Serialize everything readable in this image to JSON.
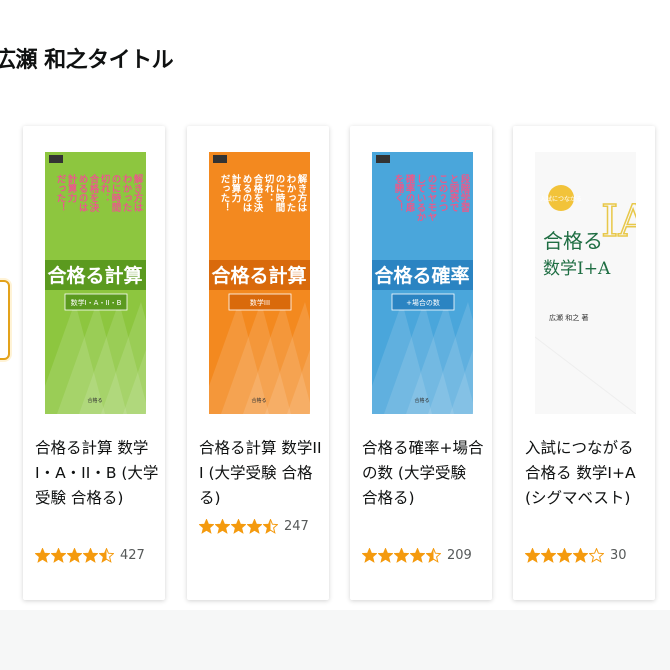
{
  "section": {
    "title": "広瀬 和之タイトル"
  },
  "colors": {
    "star": "#f49a0e",
    "focus_border": "#e3a21a"
  },
  "products": [
    {
      "title": "合格る計算 数学I・A・II・B (大学受験 合格る)",
      "rating": 4.5,
      "reviews": "427",
      "cover": {
        "bg": "#8dc63f",
        "banner": "#5b9a1f",
        "vertical_color": "#e95a8b",
        "big": "合格る計算",
        "sub": "数学I・A・II・B",
        "label": "合格る",
        "vertical": [
          "解き方は",
          "わかった",
          "のに時間",
          "切れ：",
          "合格を決",
          "めるのは",
          "計算力",
          "だった！"
        ]
      }
    },
    {
      "title": "合格る計算 数学III (大学受験 合格る)",
      "rating": 4.5,
      "reviews": "247",
      "cover": {
        "bg": "#f3891f",
        "banner": "#d96a0c",
        "vertical_color": "#ffffff",
        "big": "合格る計算",
        "sub": "数学III",
        "label": "合格る",
        "vertical": [
          "解き方は",
          "わかった",
          "のに時間",
          "切れ：",
          "合格を決",
          "めるのは",
          "計算力",
          "だった！"
        ]
      }
    },
    {
      "title": "合格る確率+場合の数 (大学受験 合格る)",
      "rating": 4.5,
      "reviews": "209",
      "cover": {
        "bg": "#4aa6db",
        "banner": "#2b84c2",
        "vertical_color": "#e95a8b",
        "big": "合格る確率",
        "sub": "+場合の数",
        "label": "合格る",
        "vertical": [
          "段階学習",
          "と図表で",
          "この２つ",
          "のモヤモヤ",
          "しているか",
          "確率の扉",
          "を開く！"
        ]
      }
    },
    {
      "title": "入試につながる 合格る 数学I+A (シグマベスト)",
      "rating": 4.0,
      "reviews": "30",
      "cover": {
        "bg": "#f8f8f8",
        "banner": "#ffffff",
        "vertical_color": "#e8c84a",
        "big": "合格る",
        "sub": "数学I+A",
        "label": "入試につながる",
        "author": "広瀬 和之 著",
        "mark": "IA"
      }
    }
  ]
}
